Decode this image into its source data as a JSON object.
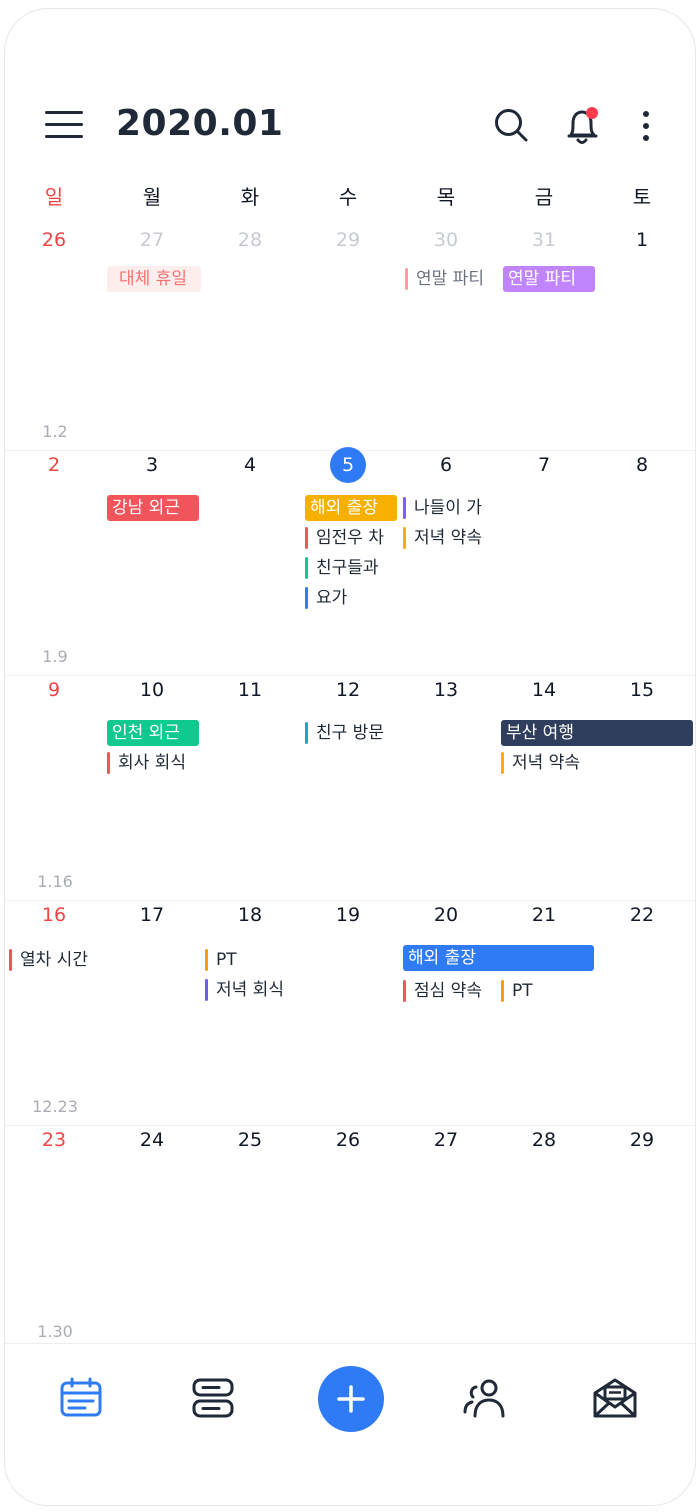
{
  "header": {
    "title": "2020.01"
  },
  "weekdays": [
    "일",
    "월",
    "화",
    "수",
    "목",
    "금",
    "토"
  ],
  "weeks": [
    {
      "label": "1.2",
      "days": [
        "26",
        "27",
        "28",
        "29",
        "30",
        "31",
        "1"
      ],
      "events": [
        {
          "title": "대체 휴일",
          "style": "soft",
          "color": "#fdeeee",
          "text_color": "#f87171"
        },
        {
          "title": "연말 파티",
          "style": "bar",
          "color": "#f8a0a0"
        },
        {
          "title": "연말 파티",
          "style": "block",
          "color": "#c084fc"
        }
      ]
    },
    {
      "label": "1.9",
      "days": [
        "2",
        "3",
        "4",
        "5",
        "6",
        "7",
        "8"
      ],
      "today": "5",
      "events": [
        {
          "title": "강남 외근",
          "style": "block",
          "color": "#f2545b"
        },
        {
          "title": "해외 출장",
          "style": "block",
          "color": "#f5b000"
        },
        {
          "title": "임전우 차",
          "style": "bar",
          "color": "#f2545b"
        },
        {
          "title": "친구들과",
          "style": "bar",
          "color": "#10c98f"
        },
        {
          "title": "요가",
          "style": "bar",
          "color": "#2f7bf5"
        },
        {
          "title": "나들이 가",
          "style": "bar",
          "color": "#7c5cff"
        },
        {
          "title": "저녁 약속",
          "style": "bar",
          "color": "#f5b000"
        }
      ]
    },
    {
      "label": "1.16",
      "days": [
        "9",
        "10",
        "11",
        "12",
        "13",
        "14",
        "15"
      ],
      "events": [
        {
          "title": "인천 외근",
          "style": "block",
          "color": "#10c98f"
        },
        {
          "title": "회사 회식",
          "style": "bar",
          "color": "#f2545b"
        },
        {
          "title": "친구 방문",
          "style": "bar",
          "color": "#1aa7c4"
        },
        {
          "title": "부산 여행",
          "style": "block",
          "color": "#2f3e5c"
        },
        {
          "title": "저녁 약속",
          "style": "bar",
          "color": "#f5b000"
        }
      ]
    },
    {
      "label": "12.23",
      "days": [
        "16",
        "17",
        "18",
        "19",
        "20",
        "21",
        "22"
      ],
      "events": [
        {
          "title": "열차 시간",
          "style": "bar",
          "color": "#f2545b"
        },
        {
          "title": "PT",
          "style": "bar",
          "color": "#f5a000"
        },
        {
          "title": "저녁 회식",
          "style": "bar",
          "color": "#6a5cf5"
        },
        {
          "title": "해외 출장",
          "style": "block",
          "color": "#2f7bf5"
        },
        {
          "title": "점심 약속",
          "style": "bar",
          "color": "#f2545b"
        },
        {
          "title": "PT",
          "style": "bar",
          "color": "#f5a000"
        }
      ]
    },
    {
      "label": "1.30",
      "days": [
        "23",
        "24",
        "25",
        "26",
        "27",
        "28",
        "29"
      ],
      "events": []
    }
  ],
  "colors": {
    "accent": "#2f7bf5",
    "sunday": "#ef4444",
    "notification_dot": "#ff3b4e",
    "muted_text": "#a9adb3"
  },
  "icons": {
    "menu": "hamburger-icon",
    "search": "search-icon",
    "notifications": "bell-icon",
    "more": "more-vertical-icon",
    "nav": [
      "calendar-icon",
      "timeline-icon",
      "plus-icon",
      "people-icon",
      "mail-icon"
    ]
  }
}
